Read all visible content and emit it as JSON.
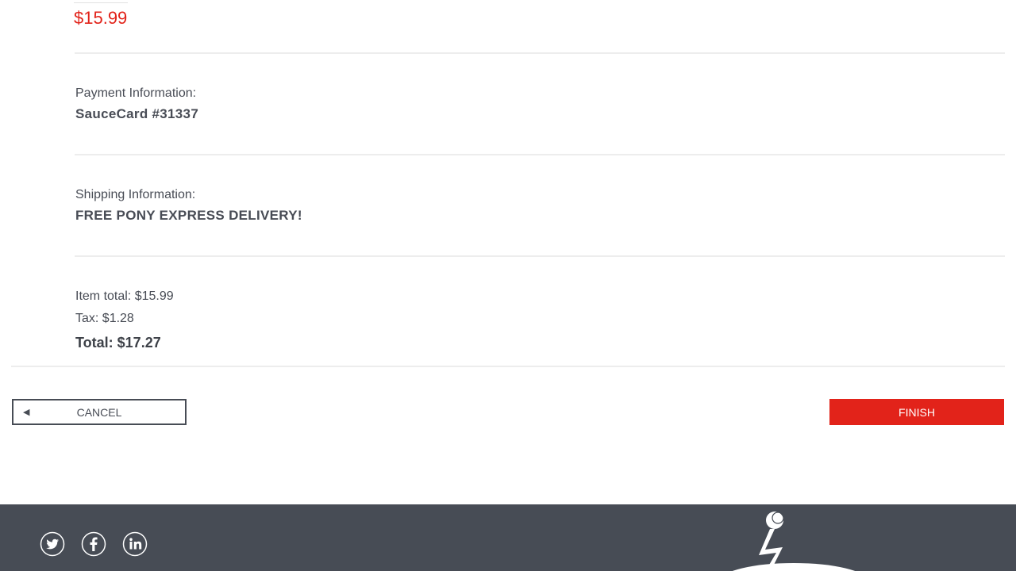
{
  "item": {
    "price": "$15.99"
  },
  "payment": {
    "label": "Payment Information:",
    "value": "SauceCard #31337"
  },
  "shipping": {
    "label": "Shipping Information:",
    "value": "FREE PONY EXPRESS DELIVERY!"
  },
  "summary": {
    "item_total": "Item total: $15.99",
    "tax": "Tax: $1.28",
    "total": "Total: $17.27"
  },
  "actions": {
    "cancel_label": "CANCEL",
    "finish_label": "FINISH"
  },
  "footer": {
    "social_icons": [
      "twitter-icon",
      "facebook-icon",
      "linkedin-icon"
    ],
    "logo_icon": "swag-bot-footer-icon"
  },
  "colors": {
    "accent": "#e2231a",
    "text": "#484c55",
    "footer_bg": "#474c55"
  }
}
